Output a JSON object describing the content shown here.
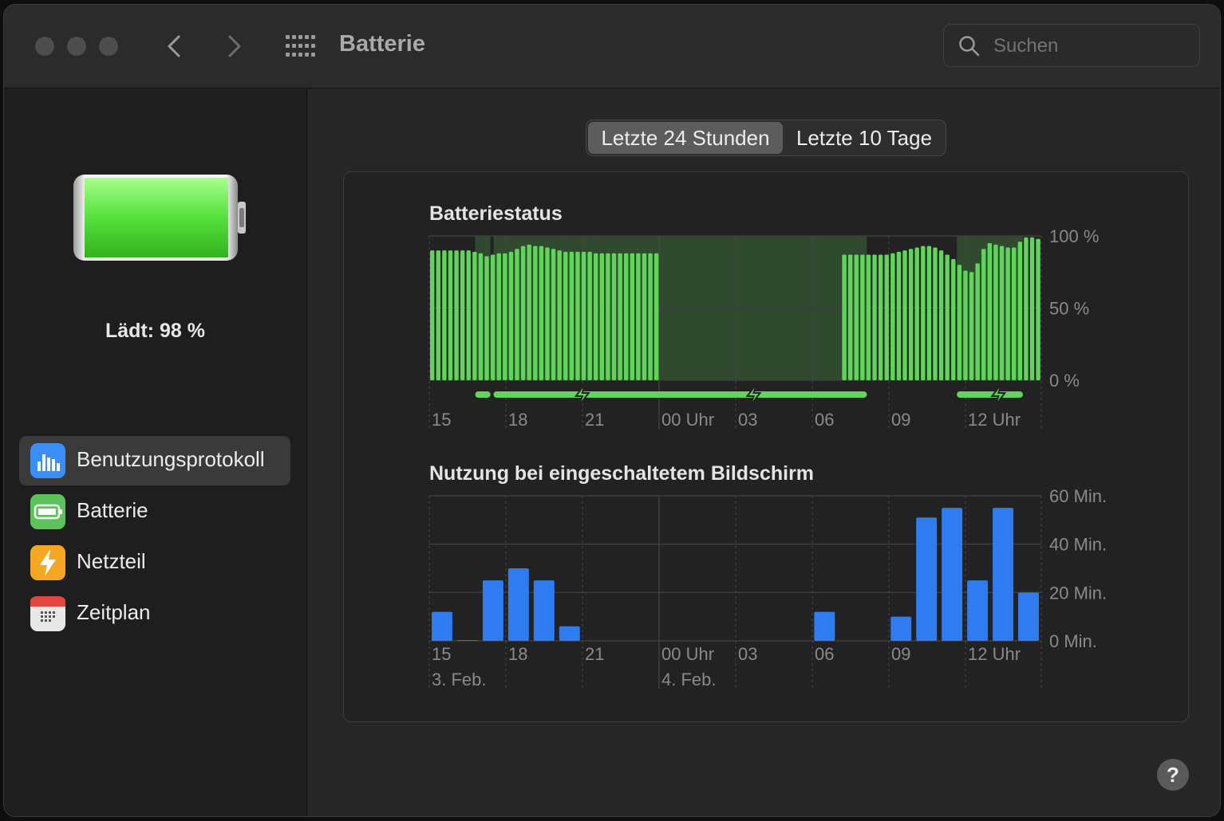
{
  "window": {
    "title": "Batterie"
  },
  "search": {
    "placeholder": "Suchen"
  },
  "sidebar": {
    "status": "Lädt: 98 %",
    "items": [
      {
        "label": "Benutzungsprotokoll",
        "icon": "usage-history-icon",
        "color": "#3a8ef6",
        "active": true
      },
      {
        "label": "Batterie",
        "icon": "battery-icon",
        "color": "#5bc35a",
        "active": false
      },
      {
        "label": "Netzteil",
        "icon": "power-adapter-icon",
        "color": "#f5a623",
        "active": false
      },
      {
        "label": "Zeitplan",
        "icon": "calendar-icon",
        "color": "#e8e8e8",
        "active": false
      }
    ]
  },
  "tabs": [
    {
      "label": "Letzte 24 Stunden",
      "active": true
    },
    {
      "label": "Letzte 10 Tage",
      "active": false
    }
  ],
  "help": {
    "label": "?"
  },
  "colors": {
    "battery_green": "#5fd65a",
    "charging_band": "#2f4a2e",
    "screen_blue": "#2f7bf0"
  },
  "chart_data": [
    {
      "type": "bar",
      "title": "Batteriestatus",
      "x_tick_labels": [
        "15",
        "18",
        "21",
        "00 Uhr",
        "03",
        "06",
        "09",
        "12 Uhr"
      ],
      "y_tick_labels": [
        "100 %",
        "50 %",
        "0 %"
      ],
      "ylim": [
        0,
        100
      ],
      "unit": "%",
      "series": [
        {
          "values": [
            90,
            90,
            90,
            90,
            90,
            90,
            90,
            89,
            88,
            86,
            87,
            88,
            88,
            89,
            91,
            93,
            94,
            93,
            93,
            92,
            91,
            90,
            89,
            89,
            89,
            89,
            89,
            88,
            88,
            88,
            88,
            88,
            88,
            88,
            88,
            88,
            88,
            88,
            null,
            null,
            null,
            null,
            null,
            null,
            null,
            null,
            null,
            null,
            null,
            null,
            null,
            null,
            null,
            null,
            null,
            null,
            null,
            null,
            null,
            null,
            null,
            null,
            null,
            null,
            null,
            null,
            null,
            null,
            87,
            87,
            87,
            87,
            87,
            87,
            87,
            87,
            88,
            89,
            90,
            91,
            92,
            93,
            93,
            92,
            90,
            87,
            84,
            80,
            76,
            75,
            81,
            91,
            95,
            94,
            93,
            92,
            92,
            96,
            99,
            99,
            98
          ]
        }
      ],
      "charging_periods": [
        [
          0.075,
          0.1
        ],
        [
          0.105,
          0.715
        ],
        [
          0.862,
          0.97
        ]
      ]
    },
    {
      "type": "bar",
      "title": "Nutzung bei eingeschaltetem Bildschirm",
      "categories": [
        "14",
        "15",
        "16",
        "17",
        "18",
        "19",
        "20",
        "21",
        "22",
        "23",
        "0",
        "1",
        "2",
        "3",
        "4",
        "5",
        "6",
        "7",
        "8",
        "9",
        "10",
        "11",
        "12",
        "13"
      ],
      "x_tick_labels": [
        "15",
        "18",
        "21",
        "00 Uhr",
        "03",
        "06",
        "09",
        "12 Uhr"
      ],
      "x_date_labels": [
        "3. Feb.",
        "4. Feb."
      ],
      "y_tick_labels": [
        "60 Min.",
        "40 Min.",
        "20 Min.",
        "0 Min."
      ],
      "ylim": [
        0,
        60
      ],
      "unit": "Min.",
      "series": [
        {
          "values": [
            12,
            0.3,
            25,
            30,
            25,
            6,
            0,
            0,
            0,
            0,
            0,
            0,
            0,
            0,
            0,
            12,
            0,
            0,
            10,
            51,
            55,
            25,
            55,
            20
          ]
        }
      ]
    }
  ]
}
